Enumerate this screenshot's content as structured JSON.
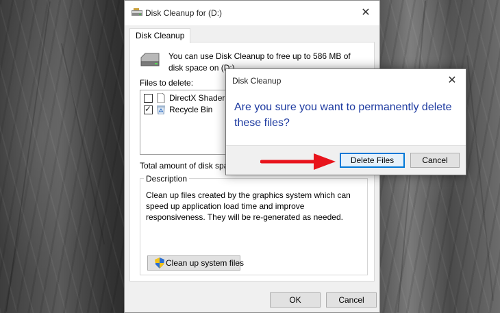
{
  "main_window": {
    "title": "Disk Cleanup for  (D:)",
    "close_glyph": "✕",
    "tab_label": "Disk Cleanup",
    "intro_text": "You can use Disk Cleanup to free up to 586 MB of disk space on  (D:).",
    "files_label": "Files to delete:",
    "files": [
      {
        "name": "DirectX Shader Ca",
        "checked": false,
        "icon": "shader-file-icon"
      },
      {
        "name": "Recycle Bin",
        "checked": true,
        "icon": "recycle-bin-icon"
      }
    ],
    "total_label": "Total amount of disk space",
    "description_legend": "Description",
    "description_text": "Clean up files created by the graphics system which can speed up application load time and improve responsiveness. They will be re-generated as needed.",
    "cleanup_system_label": "Clean up system files",
    "ok_label": "OK",
    "cancel_label": "Cancel"
  },
  "confirm_dialog": {
    "title": "Disk Cleanup",
    "close_glyph": "✕",
    "message": "Are you sure you want to permanently delete these files?",
    "delete_label": "Delete Files",
    "cancel_label": "Cancel"
  },
  "colors": {
    "message": "#1d3aa0",
    "arrow": "#e8141c",
    "focus_border": "#0078d7"
  }
}
